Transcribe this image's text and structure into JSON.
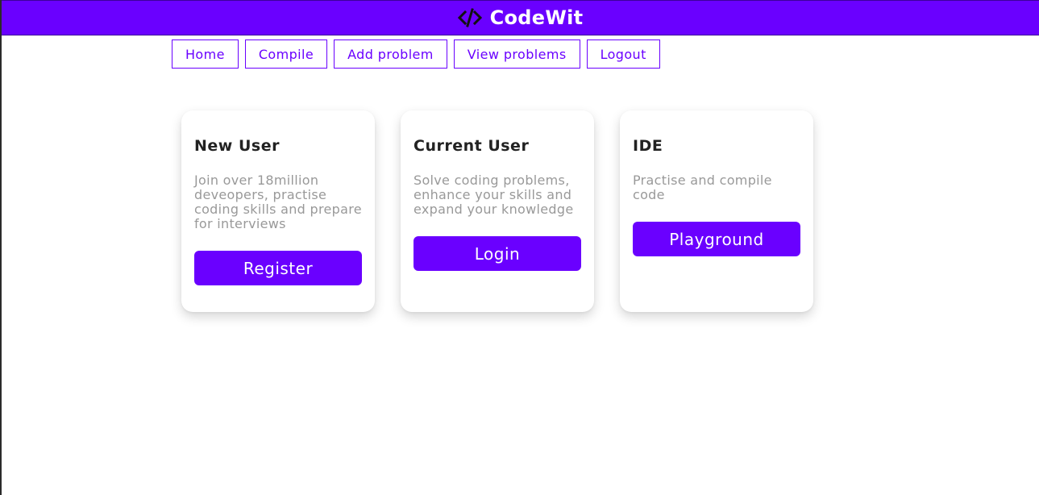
{
  "header": {
    "brand_icon": "code-icon",
    "title": "CodeWit",
    "color": "#6a00ff"
  },
  "nav": {
    "items": [
      {
        "label": "Home"
      },
      {
        "label": "Compile"
      },
      {
        "label": "Add problem"
      },
      {
        "label": "View problems"
      },
      {
        "label": "Logout"
      }
    ]
  },
  "cards": [
    {
      "title": "New User",
      "text": "Join over 18million deveopers, practise coding skills and prepare for interviews",
      "button": "Register"
    },
    {
      "title": "Current User",
      "text": "Solve coding problems, enhance your skills and expand your knowledge",
      "button": "Login"
    },
    {
      "title": "IDE",
      "text": "Practise and compile code",
      "button": "Playground"
    }
  ]
}
